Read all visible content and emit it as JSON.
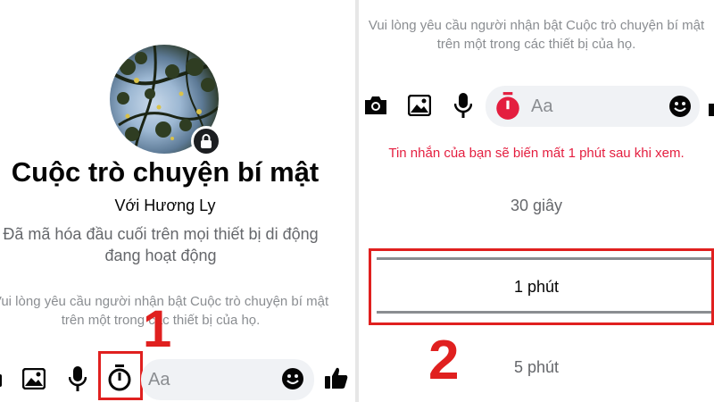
{
  "left": {
    "title": "Cuộc trò chuyện bí mật",
    "subtitle": "Với Hương Ly",
    "encryption_line1": "Đã mã hóa đầu cuối trên mọi thiết bị di động",
    "encryption_line2": "đang hoạt động",
    "hint_line1": "Vui lòng yêu cầu người nhận bật Cuộc trò chuyện bí mật",
    "hint_line2": "trên một trong các thiết bị của họ.",
    "input_placeholder": "Aa",
    "step_label": "1",
    "toolbar_icons": [
      "camera-icon",
      "image-icon",
      "microphone-icon",
      "timer-icon",
      "emoji-icon",
      "thumbs-up-icon"
    ]
  },
  "right": {
    "hint_line1": "Vui lòng yêu cầu người nhận bật Cuộc trò chuyện bí mật",
    "hint_line2": "trên một trong các thiết bị của họ.",
    "input_placeholder": "Aa",
    "notice": "Tin nhắn của bạn sẽ biến mất 1 phút sau khi xem.",
    "options": [
      "30 giây",
      "1 phút",
      "5 phút"
    ],
    "selected_option": "1 phút",
    "step_label": "2"
  },
  "colors": {
    "accent_red": "#e0201f",
    "timer_active": "#e41e3f",
    "text_primary": "#050505",
    "text_secondary": "#65676b",
    "input_bg": "#f0f2f5"
  }
}
